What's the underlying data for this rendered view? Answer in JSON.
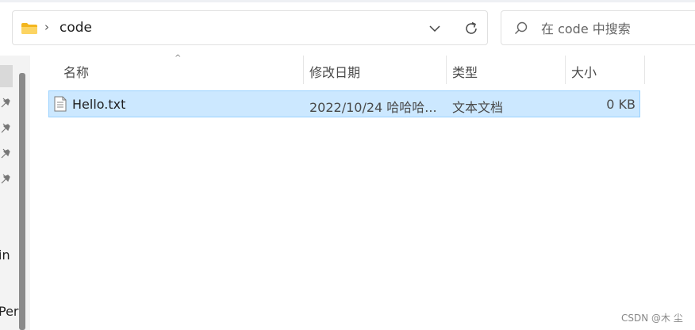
{
  "address_bar": {
    "folder": "code",
    "icons": {
      "folder": "folder-icon",
      "separator": "chevron-right-icon",
      "dropdown": "chevron-down-icon",
      "refresh": "refresh-icon"
    }
  },
  "search": {
    "placeholder": "在 code 中搜索",
    "icon": "search-icon"
  },
  "nav": {
    "items": [
      "in",
      "Per"
    ],
    "pins": 4,
    "icon": "pin-icon"
  },
  "columns": {
    "name": "名称",
    "modified": "修改日期",
    "type": "类型",
    "size": "大小",
    "sort_icon": "caret-up-icon"
  },
  "files": [
    {
      "name": "Hello.txt",
      "modified": "2022/10/24 哈哈哈...",
      "type": "文本文档",
      "size": "0 KB",
      "icon": "text-file-icon",
      "selected": true
    }
  ],
  "watermark": "CSDN @木 尘",
  "colors": {
    "selection_fill": "#cce8ff",
    "selection_border": "#99d1ff",
    "folder": "#f7c948"
  }
}
